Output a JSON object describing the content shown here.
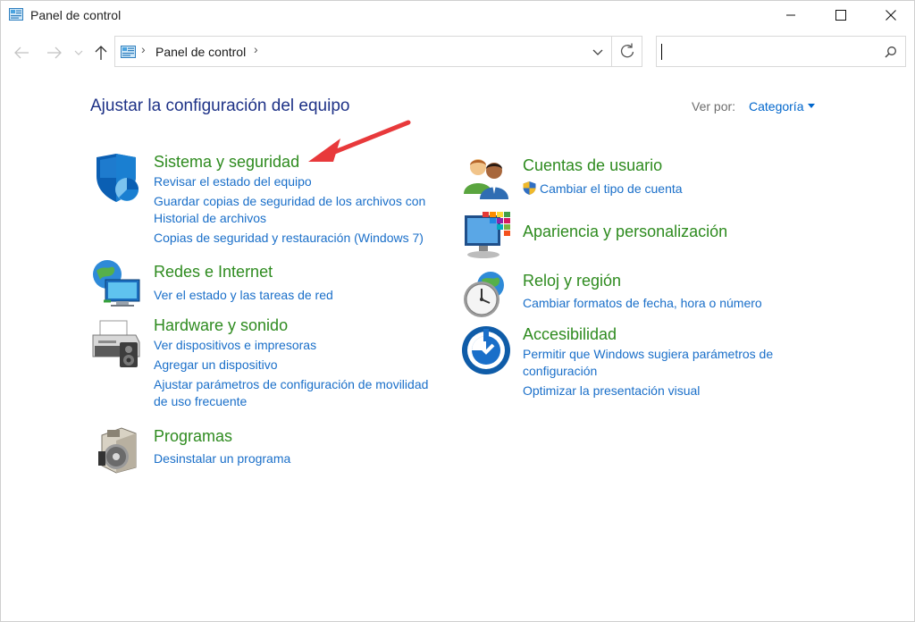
{
  "window": {
    "title": "Panel de control",
    "minimize_icon": "minimize-icon",
    "maximize_icon": "maximize-icon",
    "close_icon": "close-icon"
  },
  "nav": {
    "back_icon": "arrow-left-icon",
    "forward_icon": "arrow-right-icon",
    "recent_icon": "chevron-down-icon",
    "up_icon": "arrow-up-icon",
    "breadcrumb": [
      "Panel de control"
    ],
    "search_value": "",
    "search_icon": "magnifier-icon"
  },
  "main": {
    "heading": "Ajustar la configuración del equipo",
    "view_by_label": "Ver por:",
    "view_by_value": "Categoría",
    "left_categories": [
      {
        "title": "Sistema y seguridad",
        "icon": "shield-icon",
        "links": [
          "Revisar el estado del equipo",
          "Guardar copias de seguridad de los archivos con",
          "Historial de archivos",
          "Copias de seguridad y restauración (Windows 7)"
        ]
      },
      {
        "title": "Redes e Internet",
        "icon": "network-globe-icon",
        "links": [
          "Ver el estado y las tareas de red"
        ]
      },
      {
        "title": "Hardware y sonido",
        "icon": "printer-speaker-icon",
        "links": [
          "Ver dispositivos e impresoras",
          "Agregar un dispositivo",
          "Ajustar parámetros de configuración de movilidad",
          "de uso frecuente"
        ]
      },
      {
        "title": "Programas",
        "icon": "programs-disc-icon",
        "links": [
          "Desinstalar un programa"
        ]
      }
    ],
    "right_categories": [
      {
        "title": "Cuentas de usuario",
        "icon": "users-icon",
        "links": [
          "Cambiar el tipo de cuenta"
        ]
      },
      {
        "title": "Apariencia y personalización",
        "icon": "monitor-palette-icon",
        "links": []
      },
      {
        "title": "Reloj y región",
        "icon": "clock-globe-icon",
        "links": [
          "Cambiar formatos de fecha, hora o número"
        ]
      },
      {
        "title": "Accesibilidad",
        "icon": "accessibility-icon",
        "links": [
          "Permitir que Windows sugiera parámetros de",
          "configuración",
          "Optimizar la presentación visual"
        ]
      }
    ]
  },
  "colors": {
    "heading": "#1e3287",
    "category_title": "#2e8b1f",
    "link": "#1a6fc9",
    "annotation_arrow": "#e8393b"
  }
}
